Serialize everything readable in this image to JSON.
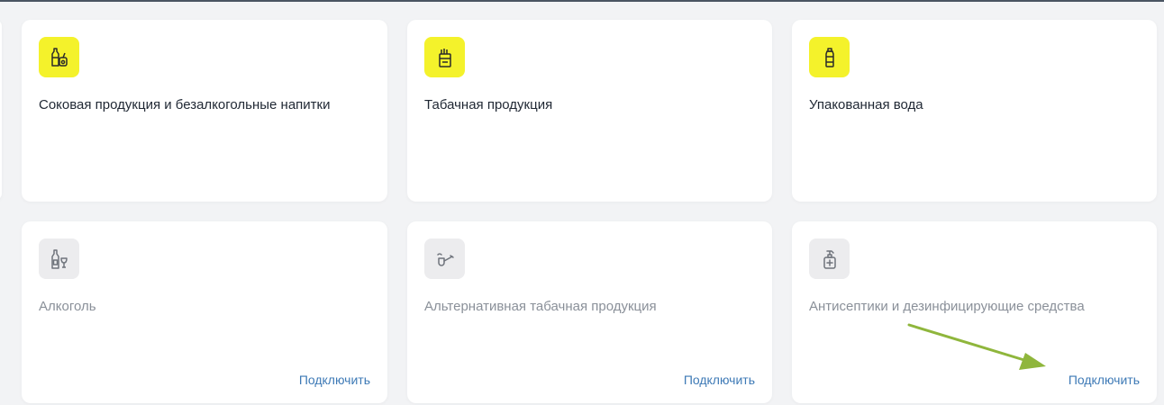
{
  "colors": {
    "active_icon_bg": "#f4f22b",
    "inactive_icon_bg": "#ececee",
    "link": "#3e7ab6",
    "annotation_arrow": "#8fb63c"
  },
  "cards": [
    {
      "title": "Соковая продукция и безалкогольные напитки",
      "icon": "juice-bottles-icon",
      "state": "active"
    },
    {
      "title": "Табачная продукция",
      "icon": "cigarette-pack-icon",
      "state": "active"
    },
    {
      "title": "Упакованная вода",
      "icon": "water-bottle-icon",
      "state": "active"
    },
    {
      "title": "Алкоголь",
      "icon": "bottle-and-glass-icon",
      "state": "inactive",
      "action": "Подключить"
    },
    {
      "title": "Альтернативная табачная продукция",
      "icon": "pipe-icon",
      "state": "inactive",
      "action": "Подключить"
    },
    {
      "title": "Антисептики и дезинфицирующие средства",
      "icon": "sanitizer-dispenser-icon",
      "state": "inactive",
      "action": "Подключить"
    }
  ]
}
